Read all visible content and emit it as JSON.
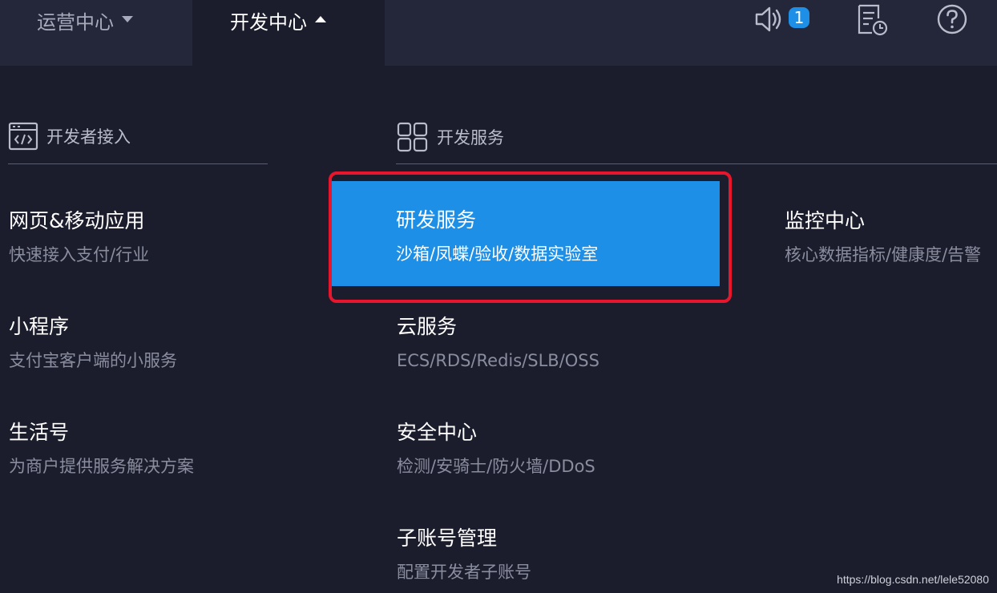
{
  "topbar": {
    "nav": [
      {
        "label": "运营中心",
        "expanded": false
      },
      {
        "label": "开发中心",
        "expanded": true
      }
    ],
    "icons": {
      "notifications": "speaker-icon",
      "notification_count": "1",
      "docs": "document-clock-icon",
      "help": "help-icon"
    }
  },
  "sections": {
    "developer_access": {
      "title": "开发者接入",
      "icon": "code-window-icon"
    },
    "developer_services": {
      "title": "开发服务",
      "icon": "grid-icon"
    }
  },
  "menu": {
    "web_mobile": {
      "title": "网页&移动应用",
      "desc": "快速接入支付/行业"
    },
    "mini_program": {
      "title": "小程序",
      "desc": "支付宝客户端的小服务"
    },
    "lifestyle": {
      "title": "生活号",
      "desc": "为商户提供服务解决方案"
    },
    "rd_services": {
      "title": "研发服务",
      "desc": "沙箱/凤蝶/验收/数据实验室"
    },
    "cloud": {
      "title": "云服务",
      "desc": "ECS/RDS/Redis/SLB/OSS"
    },
    "security": {
      "title": "安全中心",
      "desc": "检测/安骑士/防火墙/DDoS"
    },
    "subaccount": {
      "title": "子账号管理",
      "desc": "配置开发者子账号"
    },
    "monitoring": {
      "title": "监控中心",
      "desc": "核心数据指标/健康度/告警"
    }
  },
  "colors": {
    "background": "#1b1d2d",
    "topbar": "#24273a",
    "accent": "#1e8fe6",
    "annotation_frame": "#e8162c"
  },
  "watermark": "https://blog.csdn.net/lele52080"
}
